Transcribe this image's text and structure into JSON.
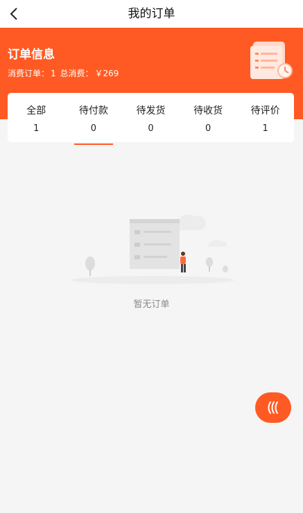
{
  "header": {
    "title": "我的订单"
  },
  "banner": {
    "title": "订单信息",
    "orders_label": "消费订单：",
    "orders_value": "1",
    "total_label": "总消费：",
    "total_value": "￥269"
  },
  "tabs": [
    {
      "label": "全部",
      "count": "1",
      "active": false
    },
    {
      "label": "待付款",
      "count": "0",
      "active": true
    },
    {
      "label": "待发货",
      "count": "0",
      "active": false
    },
    {
      "label": "待收货",
      "count": "0",
      "active": false
    },
    {
      "label": "待评价",
      "count": "1",
      "active": false
    }
  ],
  "empty": {
    "text": "暂无订单"
  },
  "colors": {
    "accent": "#ff5a23",
    "background": "#f5f5f5"
  },
  "icons": {
    "back": "back-arrow-icon",
    "float": "wave-icon"
  }
}
